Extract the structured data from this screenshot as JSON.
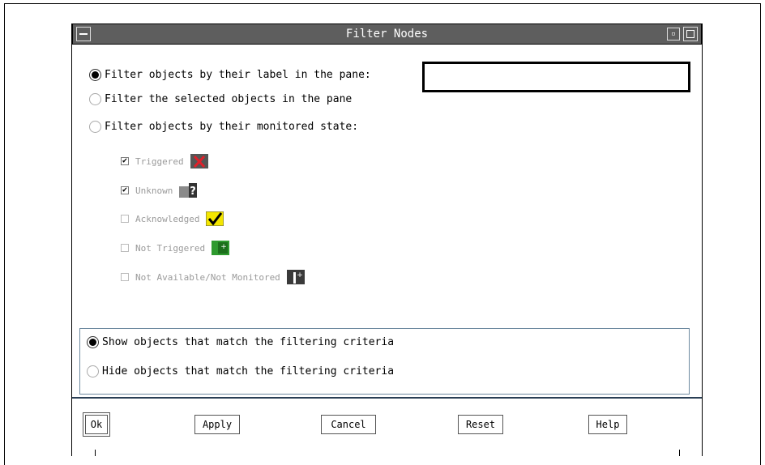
{
  "window": {
    "title": "Filter Nodes",
    "minimize_glyph": "▫"
  },
  "filter_mode": {
    "options": [
      {
        "label": "Filter objects by their label in the pane:",
        "selected": true
      },
      {
        "label": "Filter the selected objects in the pane",
        "selected": false
      },
      {
        "label": "Filter objects by their monitored state:",
        "selected": false
      }
    ],
    "label_input_value": ""
  },
  "states": [
    {
      "label": "Triggered",
      "checked": true,
      "icon": "triggered-icon"
    },
    {
      "label": "Unknown",
      "checked": true,
      "icon": "unknown-icon"
    },
    {
      "label": "Acknowledged",
      "checked": false,
      "icon": "acknowledged-icon"
    },
    {
      "label": "Not Triggered",
      "checked": false,
      "icon": "not-triggered-icon"
    },
    {
      "label": "Not Available/Not Monitored",
      "checked": false,
      "icon": "not-monitored-icon"
    }
  ],
  "show_hide": {
    "options": [
      {
        "label": "Show objects that match the filtering criteria",
        "selected": true
      },
      {
        "label": "Hide objects that match the filtering criteria",
        "selected": false
      }
    ]
  },
  "buttons": {
    "ok": "Ok",
    "apply": "Apply",
    "cancel": "Cancel",
    "reset": "Reset",
    "help": "Help"
  },
  "colors": {
    "titlebar": "#5e5e5e",
    "triggered_icon_bg": "#555555",
    "triggered_x": "#e0202a",
    "acknowledged_bg": "#f4e600",
    "not_triggered_bg": "#2e9a2e"
  }
}
